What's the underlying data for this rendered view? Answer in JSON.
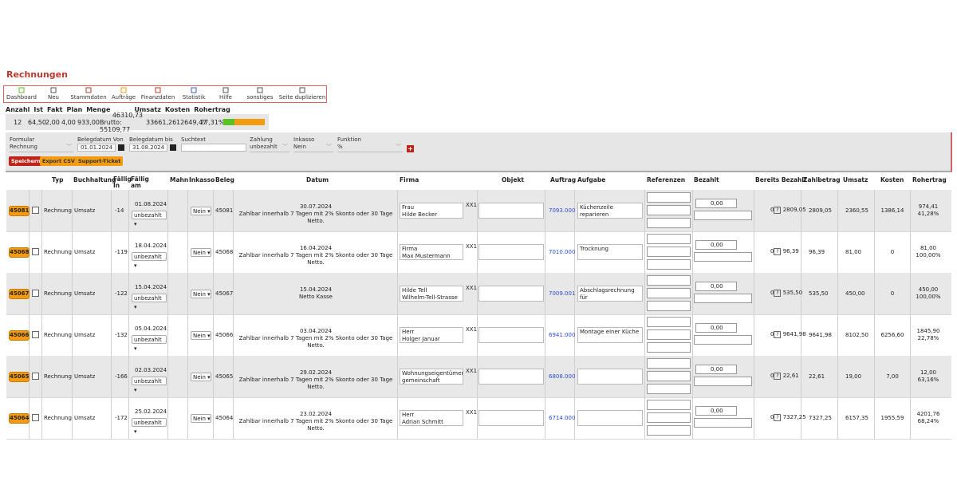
{
  "page_title": "Rechnungen",
  "toolbar": [
    {
      "label": "Dashboard",
      "icon": "home-icon",
      "color": "#58c322",
      "w": 44
    },
    {
      "label": "Neu",
      "icon": "new-document-icon",
      "color": "#555",
      "w": 36
    },
    {
      "label": "Stammdaten",
      "icon": "master-data-icon",
      "color": "#c0392b",
      "w": 52
    },
    {
      "label": "Aufträge",
      "icon": "clipboard-icon",
      "color": "#f39c12",
      "w": 36
    },
    {
      "label": "Finanzdaten",
      "icon": "money-icon",
      "color": "#c0392b",
      "w": 50
    },
    {
      "label": "Statistik",
      "icon": "chart-icon",
      "color": "#3a5fc8",
      "w": 40
    },
    {
      "label": "Hilfe",
      "icon": "info-icon",
      "color": "#555",
      "w": 40
    },
    {
      "label": "sonstiges",
      "icon": "flag-icon",
      "color": "#555",
      "w": 46
    },
    {
      "label": "Seite duplizieren",
      "icon": "double-chevron-icon",
      "color": "#555",
      "w": 60
    }
  ],
  "stats": {
    "headers": [
      "Anzahl",
      "Ist",
      "Fakt",
      "Plan",
      "Menge",
      "Umsatz",
      "Kosten",
      "Rohertrag"
    ],
    "anzahl": "12",
    "ist": "64,50",
    "fakt": "2,00",
    "plan": "4,00",
    "menge": "933,00",
    "umsatz_netto": "46310,73",
    "brutto_label": "Brutto:",
    "umsatz_brutto": "55109,77",
    "kosten": "33661,26",
    "rohertrag": "12649,47",
    "rohertrag_pct": "27,31%",
    "rohertrag_fraction": 0.2731
  },
  "filter": {
    "formular_label": "Formular",
    "formular_value": "Rechnung",
    "von_label": "Belegdatum Von",
    "von_value": "01.01.2024",
    "bis_label": "Belegdatum bis",
    "bis_value": "31.08.2024",
    "suchtext_label": "Suchtext",
    "suchtext_value": "",
    "zahlung_label": "Zahlung",
    "zahlung_value": "unbezahlt",
    "inkasso_label": "Inkasso",
    "inkasso_value": "Nein",
    "funktion_label": "Funktion",
    "funktion_value": "%",
    "save_label": "Speichern",
    "export_label": "Export CSV",
    "support_label": "Support-Ticket"
  },
  "table_headers": {
    "typ": "Typ",
    "buchhaltung": "Buchhaltung",
    "faellig_in": "Fällig In",
    "faellig_am": "Fällig am",
    "mahn": "Mahn",
    "inkasso": "Inkasso",
    "beleg": "Beleg",
    "datum": "Datum",
    "firma": "Firma",
    "objekt": "Objekt",
    "auftrag": "Auftrag",
    "aufgabe": "Aufgabe",
    "referenzen": "Referenzen",
    "bezahlt": "Bezahlt",
    "bereits_bezahlt": "Bereits Bezahlt",
    "zahlbetrag": "Zahlbetrag",
    "umsatz": "Umsatz",
    "kosten": "Kosten",
    "rohertrag": "Rohertrag"
  },
  "rows": [
    {
      "id": "45081",
      "typ": "Rechnung",
      "buch": "Umsatz",
      "in": "-14",
      "am": "01.08.2024",
      "zahl": "unbezahlt",
      "ink": "Nein",
      "beleg": "45081",
      "datum": "30.07.2024",
      "hinweis": "Zahlbar innerhalb 7 Tagen mit 2% Skonto oder 30 Tage Netto.",
      "firma1": "Frau",
      "firma2": "Hilde Becker",
      "xx": "XX1",
      "auftrag": "7093.000",
      "aufgabe1": "Küchenzeile reparieren",
      "aufgabe2": "und entsprechende",
      "bezahlt": "0,00",
      "bereits": "0",
      "bereits_val": "2809,05",
      "zahlbetrag": "2809,05",
      "umsatz": "2360,55",
      "kosten": "1386,14",
      "roh": "974,41",
      "roh_pct": "41,28%"
    },
    {
      "id": "45068",
      "typ": "Rechnung",
      "buch": "Umsatz",
      "in": "-119",
      "am": "18.04.2024",
      "zahl": "unbezahlt",
      "ink": "Nein",
      "beleg": "45068",
      "datum": "16.04.2024",
      "hinweis": "Zahlbar innerhalb 7 Tagen mit 2% Skonto oder 30 Tage Netto.",
      "firma1": "Firma",
      "firma2": "Max Mustermann",
      "xx": "XX1",
      "auftrag": "7010.000",
      "aufgabe1": "Trocknung",
      "aufgabe2": "",
      "bezahlt": "0,00",
      "bereits": "0",
      "bereits_val": "96,39",
      "zahlbetrag": "96,39",
      "umsatz": "81,00",
      "kosten": "0",
      "roh": "81,00",
      "roh_pct": "100,00%"
    },
    {
      "id": "45067",
      "typ": "Rechnung",
      "buch": "Umsatz",
      "in": "-122",
      "am": "15.04.2024",
      "zahl": "unbezahlt",
      "ink": "Nein",
      "beleg": "45067",
      "datum": "15.04.2024",
      "hinweis": "Netto Kasse",
      "firma1": "Hilde Tell",
      "firma2": "Wilhelm-Tell-Strasse",
      "xx": "XX1",
      "auftrag": "7009.001",
      "aufgabe1": "Abschlagsrechnung für",
      "aufgabe2": "Auftrag : 7009.000",
      "bezahlt": "0,00",
      "bereits": "0",
      "bereits_val": "535,50",
      "zahlbetrag": "535,50",
      "umsatz": "450,00",
      "kosten": "0",
      "roh": "450,00",
      "roh_pct": "100,00%"
    },
    {
      "id": "45066",
      "typ": "Rechnung",
      "buch": "Umsatz",
      "in": "-132",
      "am": "05.04.2024",
      "zahl": "unbezahlt",
      "ink": "Nein",
      "beleg": "45066",
      "datum": "03.04.2024",
      "hinweis": "Zahlbar innerhalb 7 Tagen mit 2% Skonto oder 30 Tage Netto.",
      "firma1": "Herr",
      "firma2": "Holger Januar",
      "xx": "XX1",
      "auftrag": "6941.000",
      "aufgabe1": "Montage einer Küche",
      "aufgabe2": "",
      "bezahlt": "0,00",
      "bereits": "0",
      "bereits_val": "9641,98",
      "zahlbetrag": "9641,98",
      "umsatz": "8102,50",
      "kosten": "6256,60",
      "roh": "1845,90",
      "roh_pct": "22,78%"
    },
    {
      "id": "45065",
      "typ": "Rechnung",
      "buch": "Umsatz",
      "in": "-166",
      "am": "02.03.2024",
      "zahl": "unbezahlt",
      "ink": "Nein",
      "beleg": "45065",
      "datum": "29.02.2024",
      "hinweis": "Zahlbar innerhalb 7 Tagen mit 2% Skonto oder 30 Tage Netto.",
      "firma1": "Wohnungseigentümer",
      "firma2": "gemeinschaft",
      "xx": "XX1",
      "auftrag": "6808.000",
      "aufgabe1": "",
      "aufgabe2": "",
      "bezahlt": "0,00",
      "bereits": "0",
      "bereits_val": "22,61",
      "zahlbetrag": "22,61",
      "umsatz": "19,00",
      "kosten": "7,00",
      "roh": "12,00",
      "roh_pct": "63,16%"
    },
    {
      "id": "45064",
      "typ": "Rechnung",
      "buch": "Umsatz",
      "in": "-172",
      "am": "25.02.2024",
      "zahl": "unbezahlt",
      "ink": "Nein",
      "beleg": "45064",
      "datum": "23.02.2024",
      "hinweis": "Zahlbar innerhalb 7 Tagen mit 2% Skonto oder 30 Tage Netto.",
      "firma1": "Herr",
      "firma2": "Adrian  Schmitt",
      "xx": "XX1",
      "auftrag": "6714.000",
      "aufgabe1": "",
      "aufgabe2": "",
      "bezahlt": "0,00",
      "bereits": "0",
      "bereits_val": "7327,25",
      "zahlbetrag": "7327,25",
      "umsatz": "6157,35",
      "kosten": "1955,59",
      "roh": "4201,76",
      "roh_pct": "68,24%"
    }
  ]
}
